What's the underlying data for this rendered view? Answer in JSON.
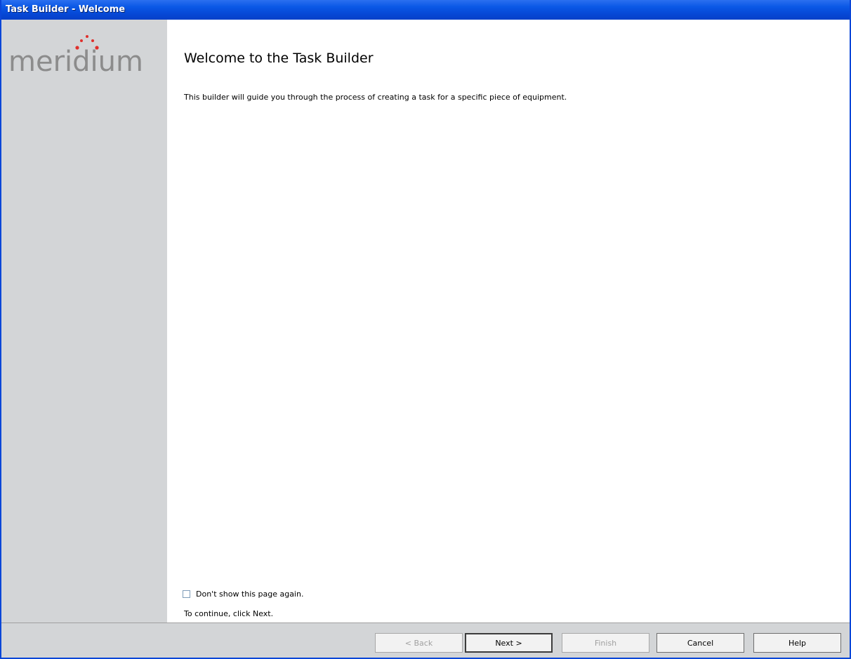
{
  "window": {
    "title": "Task Builder - Welcome"
  },
  "logo": {
    "text": "meridium",
    "dot_color": "#e0302c"
  },
  "main": {
    "heading": "Welcome to the Task Builder",
    "description": "This builder will guide you through the process of creating a task for a specific piece of equipment.",
    "checkbox_label": "Don't show this page again.",
    "checkbox_checked": false,
    "continue_text": "To continue, click Next."
  },
  "buttons": {
    "back": "< Back",
    "next": "Next >",
    "finish": "Finish",
    "cancel": "Cancel",
    "help": "Help"
  },
  "colors": {
    "titlebar": "#0a58e6",
    "sidebar": "#d3d5d7",
    "logo_text": "#8c8c8c"
  }
}
